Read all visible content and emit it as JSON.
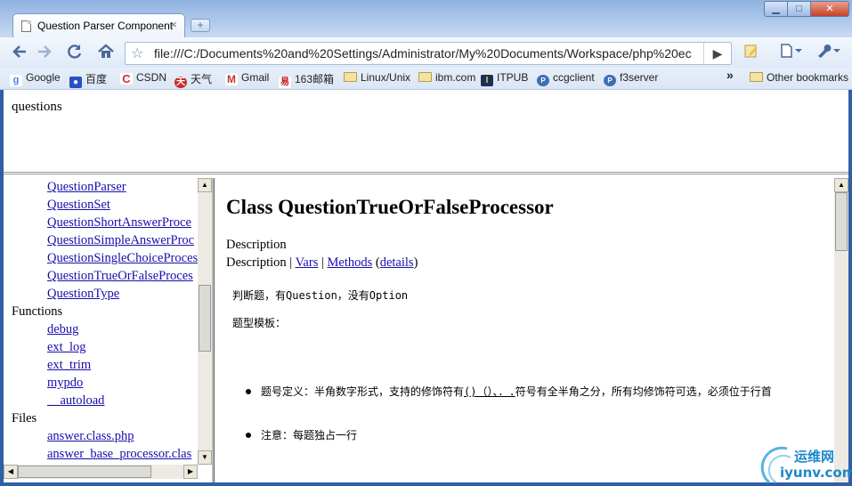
{
  "browser": {
    "tab_title": "Question Parser Component",
    "tab_close": "×",
    "new_tab": "+",
    "window_controls": {
      "minimize": "▁",
      "maximize": "□",
      "close": "✕"
    },
    "url": "file:///C:/Documents%20and%20Settings/Administrator/My%20Documents/Workspace/php%20ec",
    "icons": [
      "back-icon",
      "forward-icon",
      "reload-icon",
      "home-icon",
      "star-icon",
      "go-icon",
      "page-menu-icon",
      "wrench-icon"
    ]
  },
  "bookmarks": {
    "items": [
      {
        "label": "Google",
        "icon": "google-icon",
        "color": "#4285f4"
      },
      {
        "label": "百度",
        "icon": "baidu-icon",
        "color": "#2b4ec7"
      },
      {
        "label": "CSDN",
        "icon": "csdn-icon",
        "color": "#d62b2b"
      },
      {
        "label": "天气",
        "icon": "weather-icon",
        "color": "#c92a2a"
      },
      {
        "label": "Gmail",
        "icon": "gmail-icon",
        "color": "#c6362b"
      },
      {
        "label": "163邮箱",
        "icon": "mail163-icon",
        "color": "#c31b1b"
      },
      {
        "label": "Linux/Unix",
        "icon": "folder-icon",
        "color": "#f3e3a3"
      },
      {
        "label": "ibm.com",
        "icon": "folder-icon",
        "color": "#f3e3a3"
      },
      {
        "label": "ITPUB",
        "icon": "itpub-icon",
        "color": "#1c2f5a"
      },
      {
        "label": "ccgclient",
        "icon": "php-icon",
        "color": "#3d6eb5"
      },
      {
        "label": "f3server",
        "icon": "php-icon",
        "color": "#3d6eb5"
      }
    ],
    "overflow": "»",
    "other": "Other bookmarks"
  },
  "top_frame": {
    "title": "questions"
  },
  "left_frame": {
    "classes": [
      "QuestionParser",
      "QuestionSet",
      "QuestionShortAnswerProce",
      "QuestionSimpleAnswerProc",
      "QuestionSingleChoiceProces",
      "QuestionTrueOrFalseProces",
      "QuestionType"
    ],
    "functions_heading": "Functions",
    "functions": [
      "debug",
      "ext_log",
      "ext_trim",
      "mypdo",
      "__autoload"
    ],
    "files_heading": "Files",
    "files": [
      "answer.class.php",
      "answer_base_processor.clas"
    ]
  },
  "right_frame": {
    "heading": "Class QuestionTrueOrFalseProcessor",
    "description_label": "Description",
    "nav": {
      "description": "Description",
      "sep": " | ",
      "vars": "Vars",
      "methods": "Methods",
      "details_open": " (",
      "details": "details",
      "details_close": ")"
    },
    "intro": "判断题，有Question，没有Option",
    "template_label": "题型模板：",
    "bullets": [
      {
        "prefix": "题号定义：半角数字形式，支持的修饰符有",
        "underlined": "()（）、．.",
        "suffix": "符号有全半角之分，所有均修饰符可选，必须位于行首"
      },
      {
        "prefix": "注意：每题独占一行",
        "underlined": "",
        "suffix": ""
      }
    ]
  },
  "watermark": {
    "cn": "运维网",
    "en": "iyunv.com"
  }
}
